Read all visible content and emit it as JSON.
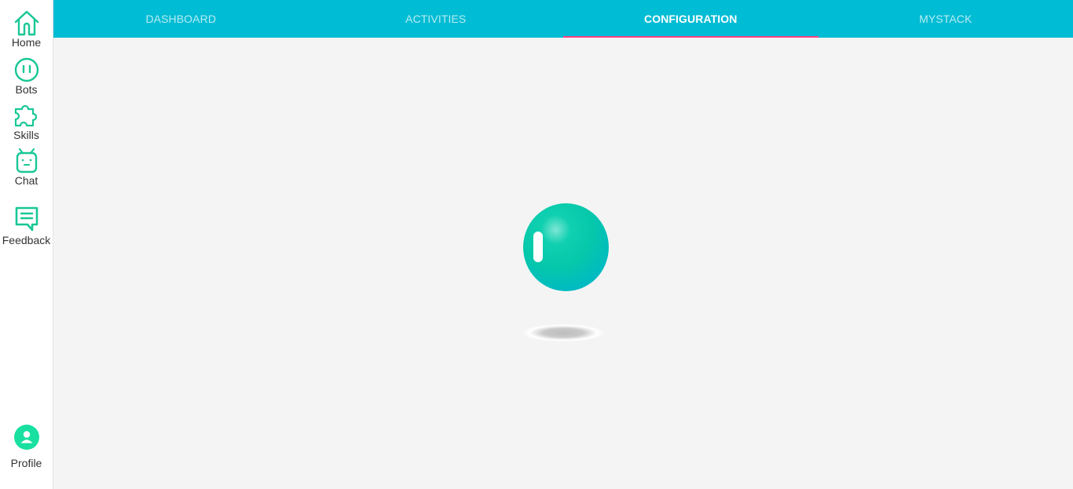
{
  "sidebar": {
    "items": [
      {
        "label": "Home",
        "icon": "home-icon"
      },
      {
        "label": "Bots",
        "icon": "bot-face-icon"
      },
      {
        "label": "Skills",
        "icon": "puzzle-icon"
      },
      {
        "label": "Chat",
        "icon": "robot-icon"
      },
      {
        "label": "Feedback",
        "icon": "feedback-icon"
      }
    ],
    "profile": {
      "label": "Profile",
      "icon": "profile-icon"
    }
  },
  "tabs": [
    {
      "label": "DASHBOARD",
      "active": false
    },
    {
      "label": "ACTIVITIES",
      "active": false
    },
    {
      "label": "CONFIGURATION",
      "active": true
    },
    {
      "label": "MYSTACK",
      "active": false
    }
  ],
  "colors": {
    "topbar": "#00bcd4",
    "accent_green": "#18c795",
    "active_indicator": "#ff4081",
    "background": "#f4f4f4"
  },
  "main": {
    "loader": "loading-ball-animation"
  }
}
